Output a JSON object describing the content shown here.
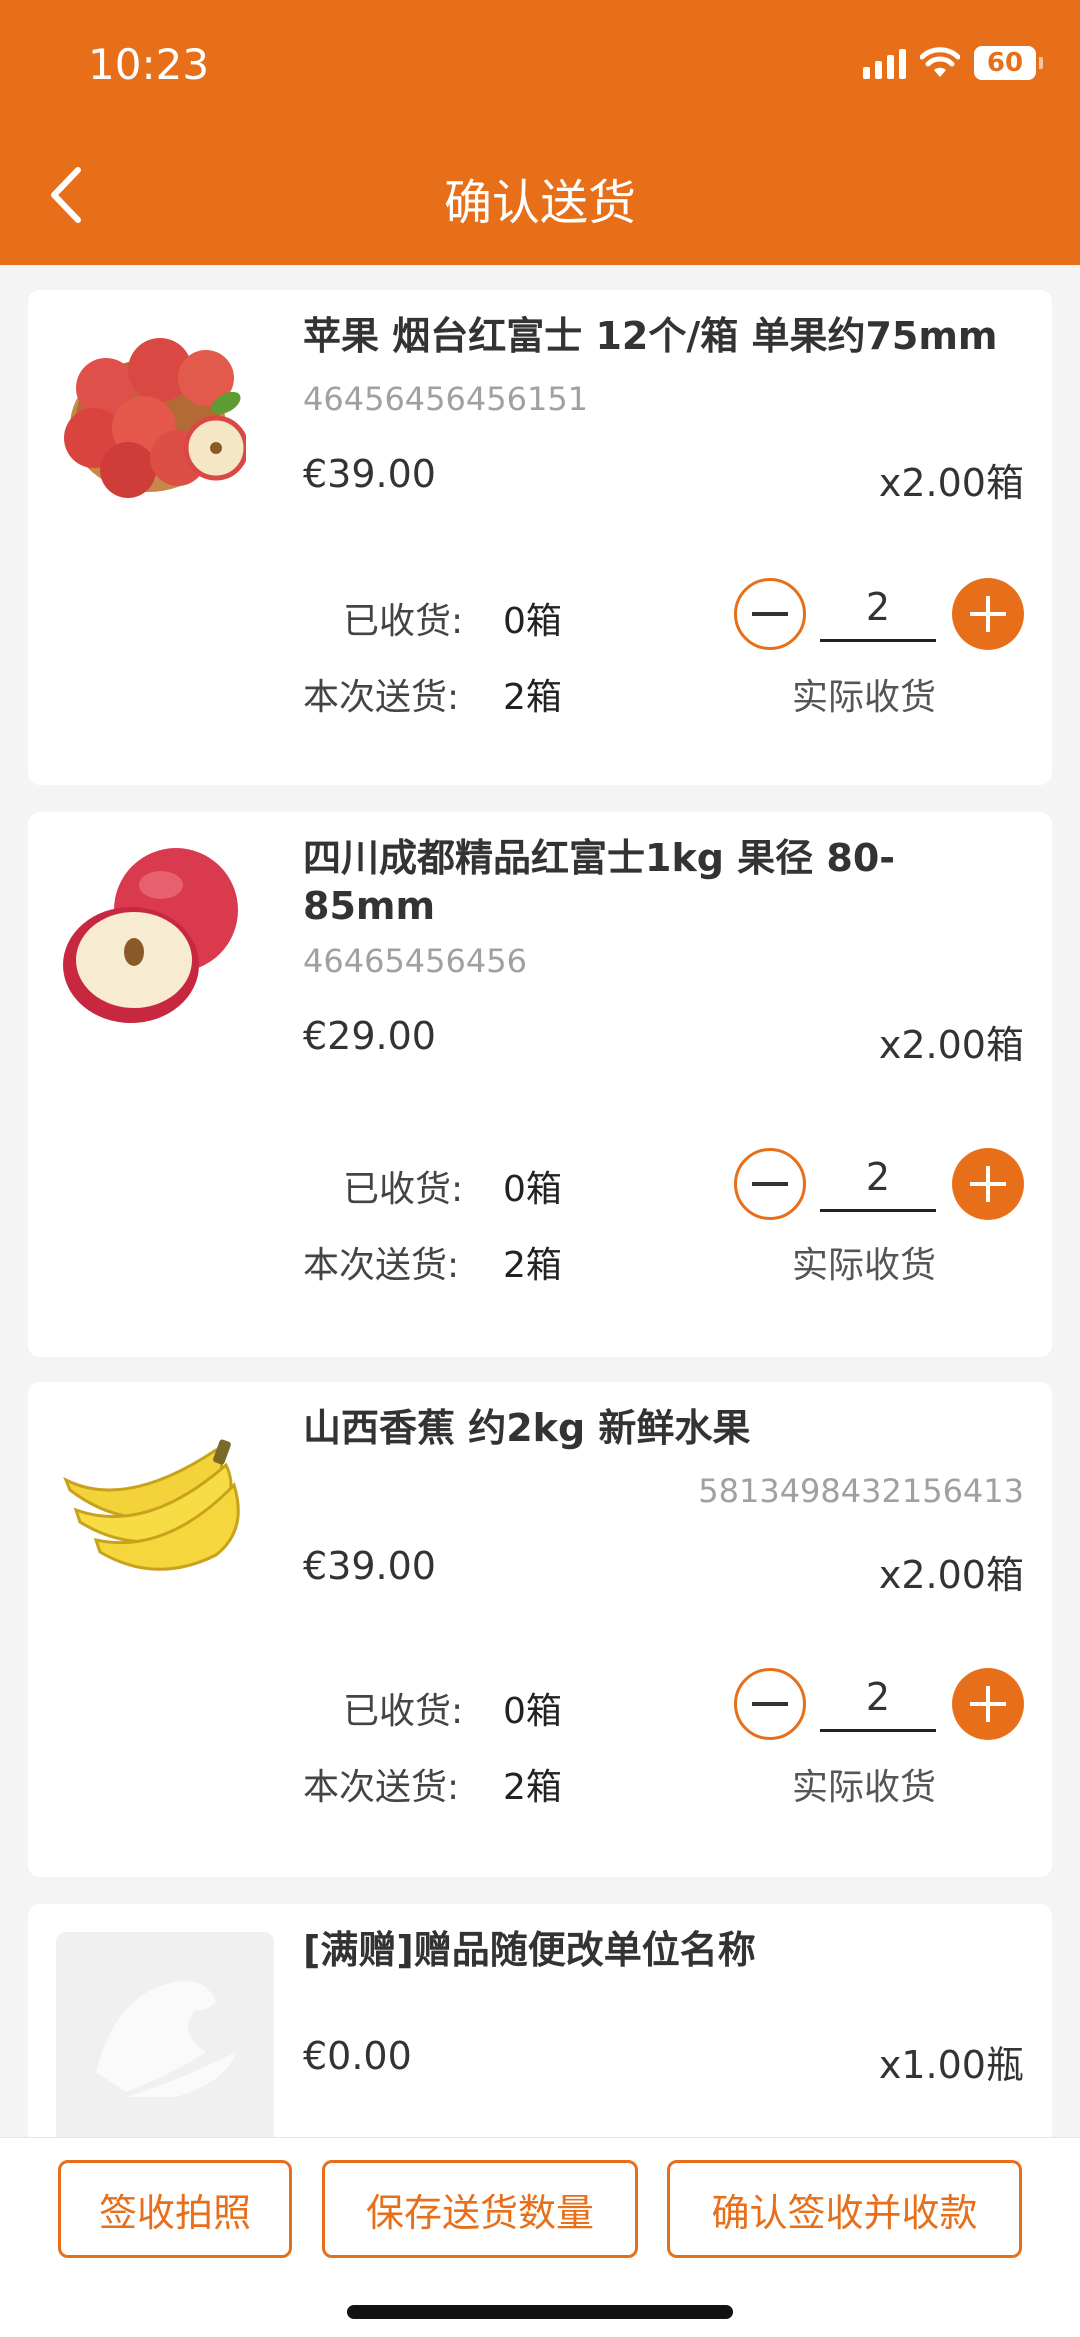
{
  "status_bar": {
    "time": "10:23",
    "battery": "60"
  },
  "header": {
    "title": "确认送货"
  },
  "items": [
    {
      "name": "苹果 烟台红富士 12个/箱 单果约75mm",
      "sku": "46456456456151",
      "price": "€39.00",
      "quantity": "x2.00箱",
      "received_label": "已收货:",
      "received_value": "0箱",
      "delivery_label": "本次送货:",
      "delivery_value": "2箱",
      "actual_qty": "2",
      "actual_label": "实际收货",
      "image": "apples-in-bowl"
    },
    {
      "name": "四川成都精品红富士1kg 果径 80-85mm",
      "sku": "46465456456",
      "price": "€29.00",
      "quantity": "x2.00箱",
      "received_label": "已收货:",
      "received_value": "0箱",
      "delivery_label": "本次送货:",
      "delivery_value": "2箱",
      "actual_qty": "2",
      "actual_label": "实际收货",
      "image": "apple-halved"
    },
    {
      "name": "山西香蕉 约2kg 新鲜水果",
      "sku": "5813498432156413",
      "price": "€39.00",
      "quantity": "x2.00箱",
      "received_label": "已收货:",
      "received_value": "0箱",
      "delivery_label": "本次送货:",
      "delivery_value": "2箱",
      "actual_qty": "2",
      "actual_label": "实际收货",
      "image": "bananas"
    },
    {
      "name": "[满赠]赠品随便改单位名称",
      "price": "€0.00",
      "quantity": "x1.00瓶",
      "image": "placeholder-horse-logo"
    }
  ],
  "footer": {
    "sign_photo": "签收拍照",
    "save_qty": "保存送货数量",
    "confirm_pay": "确认签收并收款"
  },
  "colors": {
    "accent": "#e76f19",
    "background": "#f4f4f4"
  }
}
